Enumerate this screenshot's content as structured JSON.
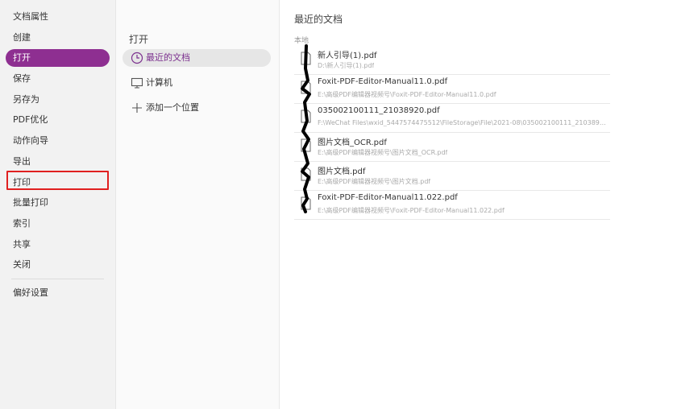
{
  "colors": {
    "accent": "#8e2f91",
    "highlight_border": "#e02020"
  },
  "sidebar": {
    "items": [
      {
        "label": "文档属性"
      },
      {
        "label": "创建"
      },
      {
        "label": "打开"
      },
      {
        "label": "保存"
      },
      {
        "label": "另存为"
      },
      {
        "label": "PDF优化"
      },
      {
        "label": "动作向导"
      },
      {
        "label": "导出"
      },
      {
        "label": "打印"
      },
      {
        "label": "批量打印"
      },
      {
        "label": "索引"
      },
      {
        "label": "共享"
      },
      {
        "label": "关闭"
      },
      {
        "label": "偏好设置"
      }
    ],
    "active": "打开",
    "highlighted": "打印"
  },
  "middle": {
    "title": "打开",
    "items": [
      {
        "label": "最近的文档",
        "icon": "clock-icon"
      },
      {
        "label": "计算机",
        "icon": "computer-icon"
      },
      {
        "label": "添加一个位置",
        "icon": "plus-icon"
      }
    ]
  },
  "right": {
    "title": "最近的文档",
    "section": "本地",
    "files": [
      {
        "name": "新人引导(1).pdf",
        "path": "D:\\新人引导(1).pdf"
      },
      {
        "name": "Foxit-PDF-Editor-Manual11.0.pdf",
        "path": "E:\\高级PDF编辑器视频号\\Foxit-PDF-Editor-Manual11.0.pdf"
      },
      {
        "name": "035002100111_21038920.pdf",
        "path": "F:\\WeChat Files\\wxid_5447574475512\\FileStorage\\File\\2021-08\\035002100111_21038920...."
      },
      {
        "name": "图片文档_OCR.pdf",
        "path": "E:\\高级PDF编辑器视频号\\图片文档_OCR.pdf"
      },
      {
        "name": "图片文档.pdf",
        "path": "E:\\高级PDF编辑器视频号\\图片文档.pdf"
      },
      {
        "name": "Foxit-PDF-Editor-Manual11.022.pdf",
        "path": "E:\\高级PDF编辑器视频号\\Foxit-PDF-Editor-Manual11.022.pdf"
      }
    ]
  }
}
